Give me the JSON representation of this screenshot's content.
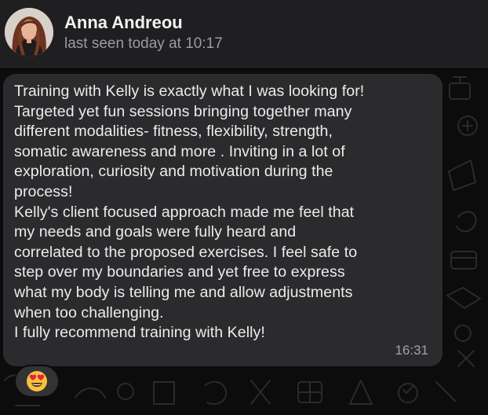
{
  "contact": {
    "name": "Anna Andreou",
    "status": "last seen today at 10:17"
  },
  "message": {
    "text": "Training with Kelly is exactly what I was looking for!\nTargeted yet fun sessions bringing together many\ndifferent modalities- fitness, flexibility, strength,\nsomatic awareness and more . Inviting in a lot of\nexploration, curiosity and motivation during the\nprocess!\nKelly's client focused approach made me feel that\nmy needs and goals were fully heard and\ncorrelated to the proposed exercises. I feel safe to\nstep over my boundaries and yet free to express\nwhat my body is telling me and allow adjustments\nwhen too challenging.\nI fully recommend training with Kelly!",
    "time": "16:31"
  },
  "reaction": {
    "emoji": "heart-eyes-emoji"
  },
  "colors": {
    "header_bg": "#1f1f21",
    "bubble_bg": "#2b2b2d",
    "chat_bg": "#0c0c0d",
    "text": "#ececec",
    "muted": "#9c9ca0"
  }
}
